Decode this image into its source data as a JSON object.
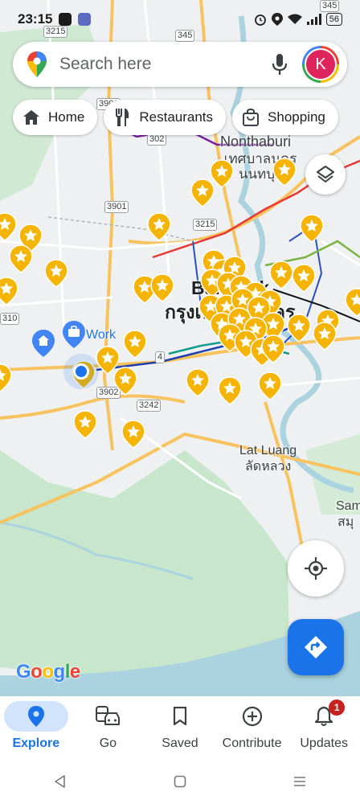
{
  "status_bar": {
    "time": "23:15",
    "battery": "56"
  },
  "search": {
    "placeholder": "Search here",
    "avatar_initial": "K"
  },
  "chips": [
    {
      "label": "Home",
      "icon": "home-icon"
    },
    {
      "label": "Restaurants",
      "icon": "restaurant-icon"
    },
    {
      "label": "Shopping",
      "icon": "shopping-bag-icon"
    }
  ],
  "map": {
    "places": {
      "nonthaburi_en": "Nonthaburi",
      "nonthaburi_th": "เทศบาลนคร นนทบุรี",
      "bangkok_en": "Bangkok",
      "bangkok_th": "กรุงเทพมหานคร",
      "lat_luang_en": "Lat Luang",
      "lat_luang_th": "ลัดหลวง",
      "samut_en": "Sam",
      "samut_th": "สมุ"
    },
    "work_label": "Work",
    "road_shields": [
      "345",
      "3215",
      "345",
      "3901",
      "302",
      "3901",
      "3215",
      "310",
      "3902",
      "3242",
      "4"
    ],
    "logo": "Google",
    "colors": {
      "saved_star": "#f4b400",
      "accent": "#1a73e8",
      "water": "#aad3df",
      "park": "#bfe3c6"
    }
  },
  "nav": {
    "explore": "Explore",
    "go": "Go",
    "saved": "Saved",
    "contribute": "Contribute",
    "updates": "Updates",
    "updates_badge": "1"
  }
}
